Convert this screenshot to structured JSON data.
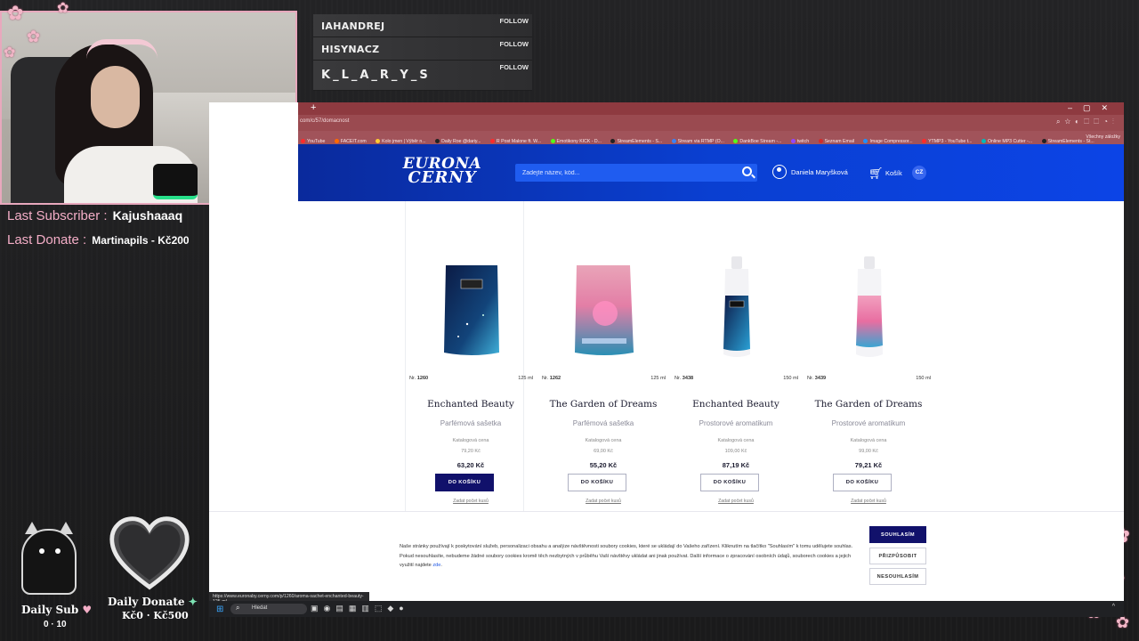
{
  "overlay": {
    "follows": [
      {
        "name": "IAHANDREJ",
        "action": "FOLLOW"
      },
      {
        "name": "HISYNACZ",
        "action": "FOLLOW"
      },
      {
        "name": "K_L_A_R_Y_S",
        "action": "FOLLOW"
      }
    ],
    "last_subscriber_label": "Last Subscriber :",
    "last_subscriber_value": "Kajushaaaq",
    "last_donate_label": "Last Donate :",
    "last_donate_value": "Martinapils - Kč200",
    "daily_sub_label": "Daily Sub",
    "daily_sub_value": "0 · 10",
    "daily_donate_label": "Daily Donate",
    "daily_donate_value": "Kč0 · Kč500"
  },
  "browser": {
    "url": "com/c/57/domacnost",
    "bookmarks": [
      "YouTube",
      "FACEIT.com",
      "Kolo jmen | Výběr n...",
      "Daily Roe @dariy...",
      "R Post Malone ft. W...",
      "Emotikony KICK - D...",
      "StreamElements - S...",
      "Stream via RTMP (O...",
      "DankBoe Stream -...",
      "twitch",
      "Seznam Email",
      "Image Compressor...",
      "YTMP3 - YouTube t...",
      "Online MP3 Cutter -...",
      "StreamElements - St..."
    ],
    "all_bookmarks": "Všechny záložky",
    "status_url": "https://www.euronaby.cerny.com/p/1260/aroma-sachet-enchanted-beauty-125-ml"
  },
  "site": {
    "logo_line1": "EURONA",
    "logo_line2": "CERNY",
    "search_placeholder": "Zadejte název, kód...",
    "user_name": "Daniela Maryšková",
    "cart_label": "Košík",
    "language": "CZ",
    "catalog_label": "Katalogová cena",
    "add_to_cart": "DO KOŠÍKU",
    "set_quantity": "Zadat počet kusů",
    "products": [
      {
        "nr_label": "Nr.",
        "nr": "1260",
        "volume": "125 ml",
        "name": "Enchanted Beauty",
        "type": "Parfémová sašetka",
        "catalog_price": "79,20 Kč",
        "price": "63,20 Kč"
      },
      {
        "nr_label": "Nr.",
        "nr": "1262",
        "volume": "125 ml",
        "name": "The Garden of Dreams",
        "type": "Parfémová sašetka",
        "catalog_price": "69,00 Kč",
        "price": "55,20 Kč"
      },
      {
        "nr_label": "Nr.",
        "nr": "3438",
        "volume": "150 ml",
        "name": "Enchanted Beauty",
        "type": "Prostorové aromatikum",
        "catalog_price": "109,00 Kč",
        "price": "87,19 Kč"
      },
      {
        "nr_label": "Nr.",
        "nr": "3439",
        "volume": "150 ml",
        "name": "The Garden of Dreams",
        "type": "Prostorové aromatikum",
        "catalog_price": "99,00 Kč",
        "price": "79,21 Kč"
      }
    ],
    "cookie_text": "Naše stránky používají k poskytování služeb, personalizaci obsahu a analýze návštěvnosti soubory cookies, které se ukládají do Vašeho zařízení. Kliknutím na tlačítko \"Souhlasím\" k tomu udělujete souhlas. Pokud nesouhlasíte, nebudeme žádné soubory cookies kromě těch nezbytných v průběhu Vaší návštěvy ukládat ani jinak používat. Další informace o zpracování osobních údajů, souborech cookies a jejich využití najdete",
    "cookie_link": "zde",
    "cookie_accept": "SOUHLASÍM",
    "cookie_customize": "PŘIZPŮSOBIT",
    "cookie_decline": "NESOUHLASÍM"
  },
  "taskbar": {
    "search_placeholder": "Hledat"
  },
  "colors": {
    "header_blue": "#0a3fd1",
    "button_navy": "#11116b",
    "accent_pink": "#f4aec7",
    "browser_chrome": "#9a4a50"
  }
}
